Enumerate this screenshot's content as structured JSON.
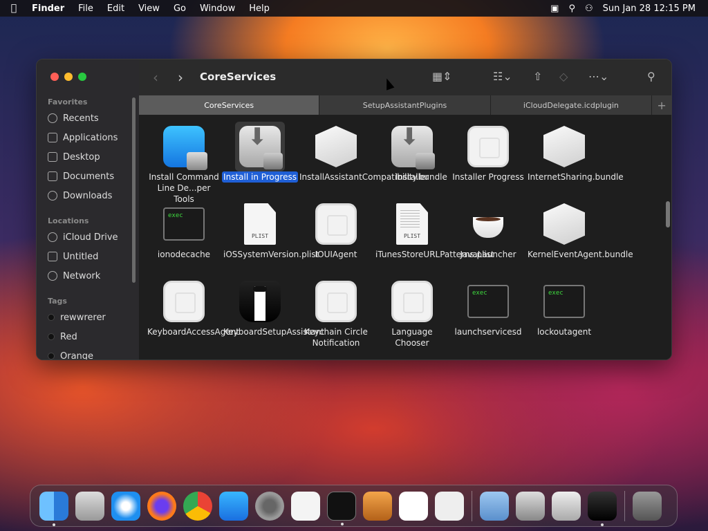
{
  "menubar": {
    "apple_icon": "apple-icon",
    "app": "Finder",
    "items": [
      "File",
      "Edit",
      "View",
      "Go",
      "Window",
      "Help"
    ],
    "datetime": "Sun Jan 28  12:15 PM"
  },
  "window": {
    "title": "CoreServices",
    "sidebar": {
      "favorites_label": "Favorites",
      "favorites": [
        "Recents",
        "Applications",
        "Desktop",
        "Documents",
        "Downloads"
      ],
      "locations_label": "Locations",
      "locations": [
        "iCloud Drive",
        "Untitled",
        "Network"
      ],
      "tags_label": "Tags",
      "tags": [
        {
          "name": "rewwrerer",
          "color": "#111111"
        },
        {
          "name": "Red",
          "color": "#111111"
        },
        {
          "name": "Orange",
          "color": "#111111"
        }
      ]
    },
    "tabs": [
      "CoreServices",
      "SetupAssistantPlugins",
      "iCloudDelegate.icdplugin"
    ],
    "tab_add": "+",
    "files": [
      {
        "name": "Install Command Line De...per Tools",
        "icon": "xcode"
      },
      {
        "name": "Install in Progress",
        "icon": "pkg",
        "selected": true
      },
      {
        "name": "InstallAssistantCompatibility.bundle",
        "icon": "bundle"
      },
      {
        "name": "Installer",
        "icon": "pkg"
      },
      {
        "name": "Installer Progress",
        "icon": "generic"
      },
      {
        "name": "InternetSharing.bundle",
        "icon": "bundle"
      },
      {
        "name": "ionodecache",
        "icon": "exec",
        "badge": "exec"
      },
      {
        "name": "iOSSystemVersion.plist",
        "icon": "plist",
        "badge": "PLIST"
      },
      {
        "name": "IOUIAgent",
        "icon": "generic"
      },
      {
        "name": "iTunesStoreURLPatterns.plist",
        "icon": "plist-lines",
        "badge": "PLIST"
      },
      {
        "name": "JavaLauncher",
        "icon": "cup"
      },
      {
        "name": "KernelEventAgent.bundle",
        "icon": "bundle"
      },
      {
        "name": "KeyboardAccessAgent",
        "icon": "generic"
      },
      {
        "name": "KeyboardSetupAssistant",
        "icon": "tux"
      },
      {
        "name": "Keychain Circle Notification",
        "icon": "generic"
      },
      {
        "name": "Language Chooser",
        "icon": "generic"
      },
      {
        "name": "launchservicesd",
        "icon": "exec",
        "badge": "exec"
      },
      {
        "name": "lockoutagent",
        "icon": "exec",
        "badge": "exec"
      }
    ]
  },
  "dock": [
    "finder-icon",
    "launchpad-icon",
    "safari-icon",
    "firefox-icon",
    "chrome-icon",
    "app-store-icon",
    "system-settings-icon",
    "textedit-icon",
    "terminal-icon",
    "garageband-icon",
    "vscode-icon",
    "blank-app-icon",
    "finder-folder-icon",
    "installer-icon",
    "system-info-icon",
    "setup-assistant-icon",
    "trash-icon"
  ]
}
